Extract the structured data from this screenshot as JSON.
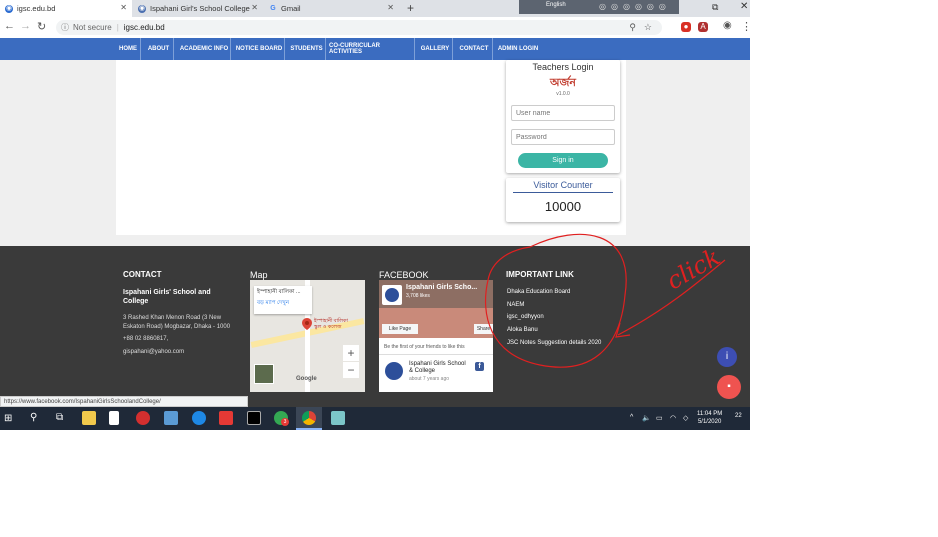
{
  "browser": {
    "tabs": [
      {
        "title": "igsc.edu.bd",
        "active": true
      },
      {
        "title": "Ispahani Girl's School College",
        "active": false
      },
      {
        "title": "Gmail",
        "active": false
      }
    ],
    "new_tab": "+",
    "lang_label": "English",
    "address": {
      "security": "Not secure",
      "url": "igsc.edu.bd"
    }
  },
  "nav": {
    "items": [
      "HOME",
      "ABOUT",
      "ACADEMIC INFO",
      "NOTICE BOARD",
      "STUDENTS",
      "CO-CURRICULAR ACTIVITIES",
      "GALLERY",
      "CONTACT",
      "ADMIN LOGIN"
    ]
  },
  "login": {
    "title": "Teachers Login",
    "logo_text": "অর্জন",
    "logo_sub": "v1.0.0",
    "username_placeholder": "User name",
    "password_placeholder": "Password",
    "signin": "Sign in"
  },
  "visitor": {
    "title": "Visitor Counter",
    "count": "10000"
  },
  "footer": {
    "contact": {
      "heading": "CONTACT",
      "school": "Ispahani Girls' School and College",
      "address": "3 Rashed Khan Menon Road (3 New Eskaton Road) Mogbazar, Dhaka - 1000",
      "phone": "+88 02 8860817,",
      "email": "gispahani@yahoo.com"
    },
    "map": {
      "heading": "Map",
      "card_title": "ইস্পাহানী বালিকা ...",
      "card_link": "বড় ম্যাপ দেখুন",
      "pin_label": "ইস্পাহানী বালিকা স্কুল ও কলেজ",
      "zoom_in": "+",
      "zoom_out": "−",
      "brand": "Google"
    },
    "facebook": {
      "heading": "FACEBOOK",
      "page_name": "Ispahani Girls Scho...",
      "likes": "3,708 likes",
      "like_btn": "Like Page",
      "share_btn": "Share",
      "friends_text": "Be the first of your friends to like this",
      "post_name": "Ispahani Girls School & College",
      "post_time": "about 7 years ago"
    },
    "important": {
      "heading": "IMPORTANT LINK",
      "links": [
        "Dhaka Education Board",
        "NAEM",
        "igsc_odhyyon",
        "Aloka Banu",
        "JSC Notes Suggestion details 2020"
      ]
    }
  },
  "annotation": {
    "text": "click"
  },
  "status_url": "https://www.facebook.com/IspahaniGirlsSchoolandCollege/",
  "taskbar": {
    "time": "11:04 PM",
    "date": "5/1/2020",
    "notifications": "22",
    "chrome_badge": "3"
  },
  "colors": {
    "nav_blue": "#3b6cc0",
    "footer_dark": "#3a3a3a",
    "signin_teal": "#3bb5a5",
    "annotation_red": "#e02020"
  }
}
